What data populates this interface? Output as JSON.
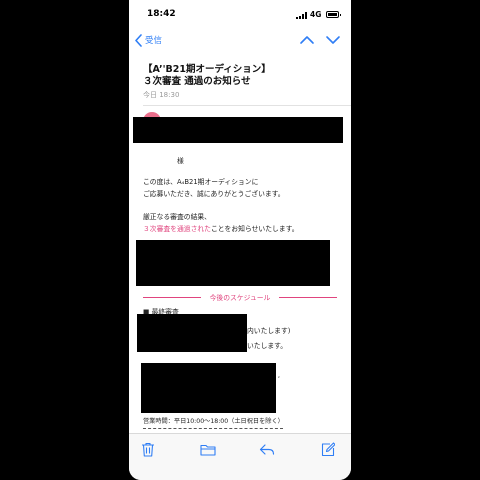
{
  "status_bar": {
    "time": "18:42",
    "network": "4G"
  },
  "nav": {
    "back_label": "受信"
  },
  "mail": {
    "subject_line1": "【A’'B21期オーディション】",
    "subject_line2": "３次審査 通過のお知らせ",
    "date": "今日 18:30",
    "greeting": "様",
    "para1_line1": "この度は、A₄B21期オーディションに",
    "para1_line2": "ご応募いただき、誠にありがとうございます。",
    "para2_line1": "厳正なる審査の結果、",
    "para2_highlight": "３次審査を通過された",
    "para2_rest": "ことをお知らせいたします。",
    "schedule_title": "今後のスケジュール",
    "final_review": "■ 最終審査",
    "partial1": "内いたします)",
    "partial2": "いたします。",
    "partial3": "ʹ",
    "business_hours": "営業時間：平日10:00～18:00（土日祝日を除く）"
  },
  "colors": {
    "accent": "#2f7ef5",
    "highlight": "#e0447e",
    "avatar": "#ea6f8c"
  },
  "icons": {
    "toolbar": [
      "trash-icon",
      "folder-icon",
      "reply-icon",
      "compose-icon"
    ],
    "nav": [
      "chevron-left-icon",
      "chevron-up-icon",
      "chevron-down-icon"
    ]
  }
}
